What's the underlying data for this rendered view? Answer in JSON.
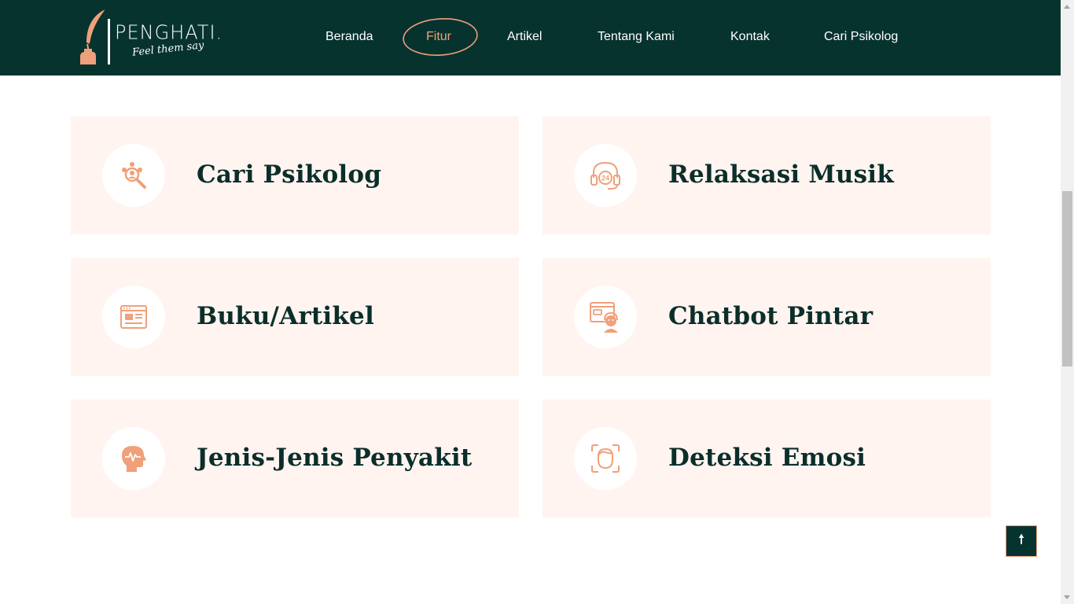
{
  "brand": {
    "name": "PENGHATI.",
    "tagline": "Feel them say",
    "logo_icon": "quill-inkwell-icon"
  },
  "nav": {
    "items": [
      {
        "label": "Beranda",
        "active": false
      },
      {
        "label": "Fitur",
        "active": true
      },
      {
        "label": "Artikel",
        "active": false
      },
      {
        "label": "Tentang Kami",
        "active": false
      },
      {
        "label": "Kontak",
        "active": false
      },
      {
        "label": "Cari Psikolog",
        "active": false
      }
    ]
  },
  "features": [
    {
      "title": "Cari Psikolog",
      "icon": "people-search-icon"
    },
    {
      "title": "Relaksasi Musik",
      "icon": "headphones-24-icon"
    },
    {
      "title": "Buku/Artikel",
      "icon": "browser-article-icon"
    },
    {
      "title": "Chatbot Pintar",
      "icon": "chatbot-agent-icon"
    },
    {
      "title": "Jenis-Jenis Penyakit",
      "icon": "head-heartbeat-icon"
    },
    {
      "title": "Deteksi Emosi",
      "icon": "face-scan-icon"
    }
  ],
  "back_to_top": {
    "icon": "arrow-up-icon",
    "glyph": "🠕"
  },
  "colors": {
    "navbar_bg": "#07332f",
    "accent": "#f0a07a",
    "card_bg": "#fff4f0",
    "title_text": "#0b2e2a"
  }
}
